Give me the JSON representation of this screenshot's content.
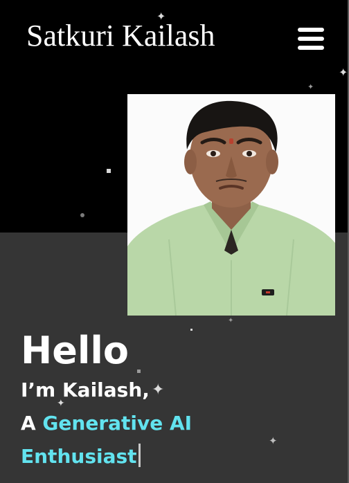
{
  "header": {
    "site_title": "Satkuri Kailash",
    "menu_icon": "hamburger-menu-icon"
  },
  "hero": {
    "photo_icon": "profile-photo",
    "greeting": "Hello",
    "intro": "I’m Kailash,",
    "role_prefix": "A",
    "role_highlight_1": "Generative AI",
    "role_highlight_2": "Enthusiast"
  },
  "colors": {
    "top_background": "#000000",
    "bottom_background": "#353535",
    "text": "#ffffff",
    "accent": "#62e3ef"
  }
}
